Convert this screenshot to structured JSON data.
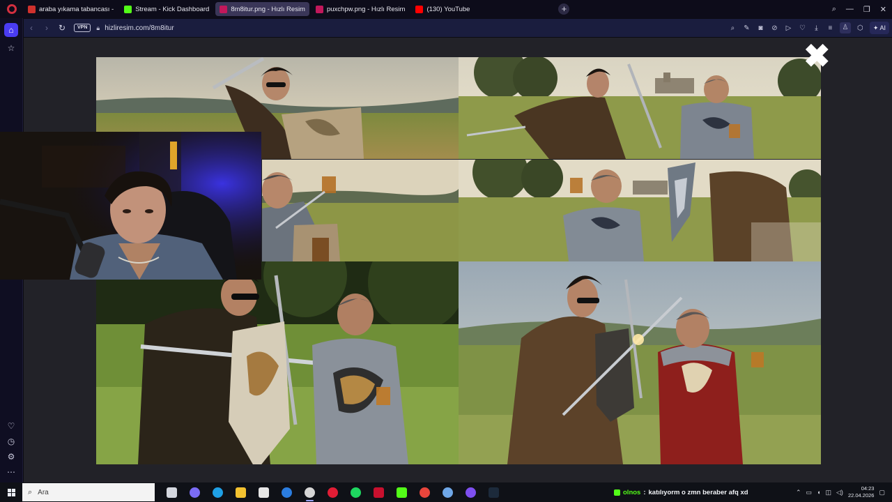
{
  "browser": {
    "tabs": [
      {
        "title": "araba yıkama tabancası - ",
        "fav_color": "#d0312d",
        "active": false
      },
      {
        "title": "Stream - Kick Dashboard",
        "fav_color": "#53fc18",
        "active": false
      },
      {
        "title": "8m8itur.png - Hızlı Resim",
        "fav_color": "#c2185b",
        "active": true
      },
      {
        "title": "puxchpw.png - Hızlı Resim",
        "fav_color": "#c2185b",
        "active": false
      },
      {
        "title": "(130) YouTube",
        "fav_color": "#ff0000",
        "active": false
      }
    ],
    "new_tab_glyph": "+",
    "vpn_label": "VPN",
    "url": "hizliresim.com/8m8itur",
    "ai_label": "AI",
    "accent_color": "#4a3cf2"
  },
  "viewer": {
    "close_glyph": "✖",
    "photos": [
      {
        "name": "photo-top-left",
        "scene": "man-with-sword-and-shield"
      },
      {
        "name": "photo-top-right",
        "scene": "man-versus-knight-with-drink"
      },
      {
        "name": "photo-middle-left",
        "scene": "knight-holding-glass"
      },
      {
        "name": "photo-middle-right",
        "scene": "knight-versus-shield-bearer"
      },
      {
        "name": "photo-bottom-left",
        "scene": "swordfight-in-green-field"
      },
      {
        "name": "photo-bottom-right",
        "scene": "swordfight-at-golden-hour"
      }
    ]
  },
  "taskbar": {
    "search_placeholder": "Ara",
    "apps": [
      {
        "icon": "task-view-icon",
        "color": "#d4d7df"
      },
      {
        "icon": "copilot-icon",
        "color": "#7b6cf6"
      },
      {
        "icon": "edge-icon",
        "color": "#1fa0e6"
      },
      {
        "icon": "file-explorer-icon",
        "color": "#f3c230"
      },
      {
        "icon": "store-icon",
        "color": "#e6e6e6"
      },
      {
        "icon": "mail-icon",
        "color": "#2b7de0"
      },
      {
        "icon": "obs-icon",
        "color": "#d6d6d6"
      },
      {
        "icon": "opera-icon",
        "color": "#e11d35"
      },
      {
        "icon": "spotify-icon",
        "color": "#1ed760"
      },
      {
        "icon": "capcut-icon",
        "color": "#c8102e"
      },
      {
        "icon": "kick-icon",
        "color": "#53fc18"
      },
      {
        "icon": "chrome-icon",
        "color": "#e8453c"
      },
      {
        "icon": "settings-icon",
        "color": "#6fa7e8"
      },
      {
        "icon": "discord-icon",
        "color": "#7e4ff0"
      },
      {
        "icon": "terminal-icon",
        "color": "#1c2a3b"
      }
    ],
    "chat": {
      "username": "olnos",
      "separator": ":",
      "message": "katılıyorm o zmn beraber afq xd"
    },
    "time": "04:23",
    "date": "22.04.2026"
  }
}
